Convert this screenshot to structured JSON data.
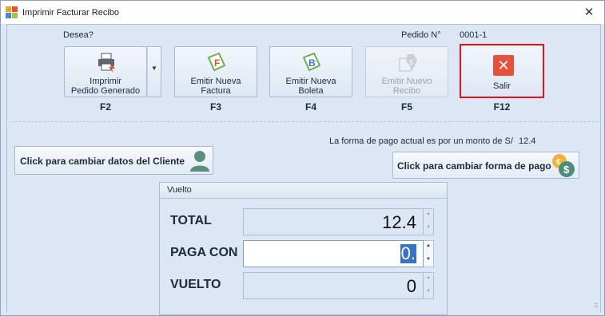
{
  "window": {
    "title": "Imprimir Facturar Recibo"
  },
  "header": {
    "desea_label": "Desea?",
    "pedido_label": "Pedido N°",
    "pedido_value": "0001-1"
  },
  "toolbar": {
    "print": {
      "label": "Imprimir\nPedido Generado",
      "key": "F2",
      "icon": "printer-icon"
    },
    "factura": {
      "label": "Emitir Nueva\nFactura",
      "key": "F3",
      "icon": "invoice-f-icon"
    },
    "boleta": {
      "label": "Emitir Nueva\nBoleta",
      "key": "F4",
      "icon": "receipt-b-icon"
    },
    "recibo": {
      "label": "Emitir Nuevo\nRecibo",
      "key": "F5",
      "icon": "receipt-tag-icon",
      "enabled": false
    },
    "salir": {
      "label": "Salir",
      "key": "F12",
      "icon": "close-icon"
    }
  },
  "payment": {
    "info_prefix": "La forma de pago actual es  por un monto de S/",
    "amount": "12.4"
  },
  "buttons": {
    "cliente": "Click para cambiar datos del Cliente",
    "forma_pago": "Click para cambiar forma de pago"
  },
  "vuelto": {
    "title": "Vuelto",
    "total_label": "TOTAL",
    "total_value": "12.4",
    "paga_label": "PAGA CON",
    "paga_value": "0.",
    "vuelto_label": "VUELTO",
    "vuelto_value": "0"
  },
  "colors": {
    "accent": "#3573c5",
    "highlight_border": "#e81313",
    "close_red": "#e5513a"
  }
}
